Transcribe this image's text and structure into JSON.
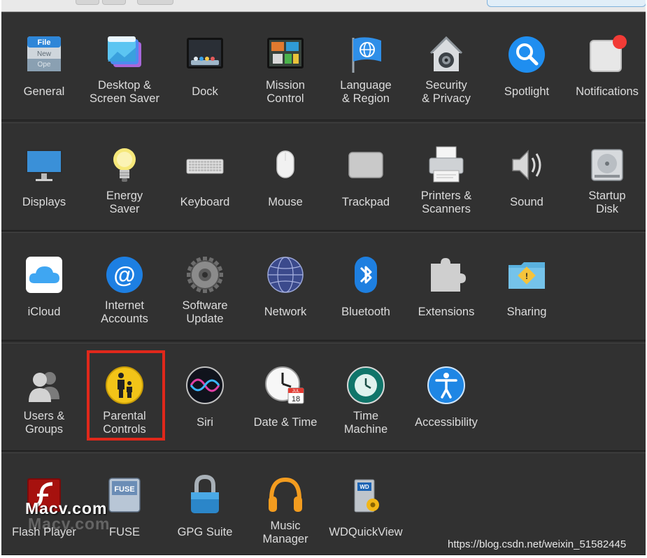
{
  "watermark": {
    "site": "Macv.com",
    "url": "https://blog.csdn.net/weixin_51582445"
  },
  "colors": {
    "highlight": "#e0281b",
    "background": "#2b2b2b"
  },
  "rows": [
    [
      {
        "id": "general",
        "label": [
          "General"
        ],
        "icon": "general-icon",
        "icon_text": [
          "File",
          "New",
          "Ope"
        ]
      },
      {
        "id": "desktop-screen-saver",
        "label": [
          "Desktop &",
          "Screen Saver"
        ],
        "icon": "desktop-screen-saver-icon"
      },
      {
        "id": "dock",
        "label": [
          "Dock"
        ],
        "icon": "dock-icon"
      },
      {
        "id": "mission-control",
        "label": [
          "Mission",
          "Control"
        ],
        "icon": "mission-control-icon"
      },
      {
        "id": "language-region",
        "label": [
          "Language",
          "& Region"
        ],
        "icon": "language-region-icon"
      },
      {
        "id": "security-privacy",
        "label": [
          "Security",
          "& Privacy"
        ],
        "icon": "security-privacy-icon"
      },
      {
        "id": "spotlight",
        "label": [
          "Spotlight"
        ],
        "icon": "spotlight-icon"
      },
      {
        "id": "notifications",
        "label": [
          "Notifications"
        ],
        "icon": "notifications-icon"
      }
    ],
    [
      {
        "id": "displays",
        "label": [
          "Displays"
        ],
        "icon": "displays-icon"
      },
      {
        "id": "energy-saver",
        "label": [
          "Energy",
          "Saver"
        ],
        "icon": "energy-saver-icon"
      },
      {
        "id": "keyboard",
        "label": [
          "Keyboard"
        ],
        "icon": "keyboard-icon"
      },
      {
        "id": "mouse",
        "label": [
          "Mouse"
        ],
        "icon": "mouse-icon"
      },
      {
        "id": "trackpad",
        "label": [
          "Trackpad"
        ],
        "icon": "trackpad-icon"
      },
      {
        "id": "printers-scanners",
        "label": [
          "Printers &",
          "Scanners"
        ],
        "icon": "printers-scanners-icon"
      },
      {
        "id": "sound",
        "label": [
          "Sound"
        ],
        "icon": "sound-icon"
      },
      {
        "id": "startup-disk",
        "label": [
          "Startup",
          "Disk"
        ],
        "icon": "startup-disk-icon"
      }
    ],
    [
      {
        "id": "icloud",
        "label": [
          "iCloud"
        ],
        "icon": "icloud-icon"
      },
      {
        "id": "internet-accounts",
        "label": [
          "Internet",
          "Accounts"
        ],
        "icon": "internet-accounts-icon"
      },
      {
        "id": "software-update",
        "label": [
          "Software",
          "Update"
        ],
        "icon": "software-update-icon"
      },
      {
        "id": "network",
        "label": [
          "Network"
        ],
        "icon": "network-icon"
      },
      {
        "id": "bluetooth",
        "label": [
          "Bluetooth"
        ],
        "icon": "bluetooth-icon"
      },
      {
        "id": "extensions",
        "label": [
          "Extensions"
        ],
        "icon": "extensions-icon"
      },
      {
        "id": "sharing",
        "label": [
          "Sharing"
        ],
        "icon": "sharing-icon"
      }
    ],
    [
      {
        "id": "users-groups",
        "label": [
          "Users &",
          "Groups"
        ],
        "icon": "users-groups-icon"
      },
      {
        "id": "parental-controls",
        "label": [
          "Parental",
          "Controls"
        ],
        "icon": "parental-controls-icon",
        "highlighted": true
      },
      {
        "id": "siri",
        "label": [
          "Siri"
        ],
        "icon": "siri-icon"
      },
      {
        "id": "date-time",
        "label": [
          "Date & Time"
        ],
        "icon": "date-time-icon",
        "icon_text": [
          "JUL",
          "18"
        ]
      },
      {
        "id": "time-machine",
        "label": [
          "Time",
          "Machine"
        ],
        "icon": "time-machine-icon"
      },
      {
        "id": "accessibility",
        "label": [
          "Accessibility"
        ],
        "icon": "accessibility-icon"
      }
    ],
    [
      {
        "id": "flash-player",
        "label": [
          "Flash Player"
        ],
        "icon": "flash-player-icon"
      },
      {
        "id": "fuse",
        "label": [
          "FUSE"
        ],
        "icon": "fuse-icon",
        "icon_text": [
          "FUSE"
        ]
      },
      {
        "id": "gpg-suite",
        "label": [
          "GPG Suite"
        ],
        "icon": "gpg-suite-icon"
      },
      {
        "id": "music-manager",
        "label": [
          "Music",
          "Manager"
        ],
        "icon": "music-manager-icon"
      },
      {
        "id": "wdquickview",
        "label": [
          "WDQuickView"
        ],
        "icon": "wdquickview-icon",
        "icon_text": [
          "WD"
        ]
      }
    ]
  ]
}
